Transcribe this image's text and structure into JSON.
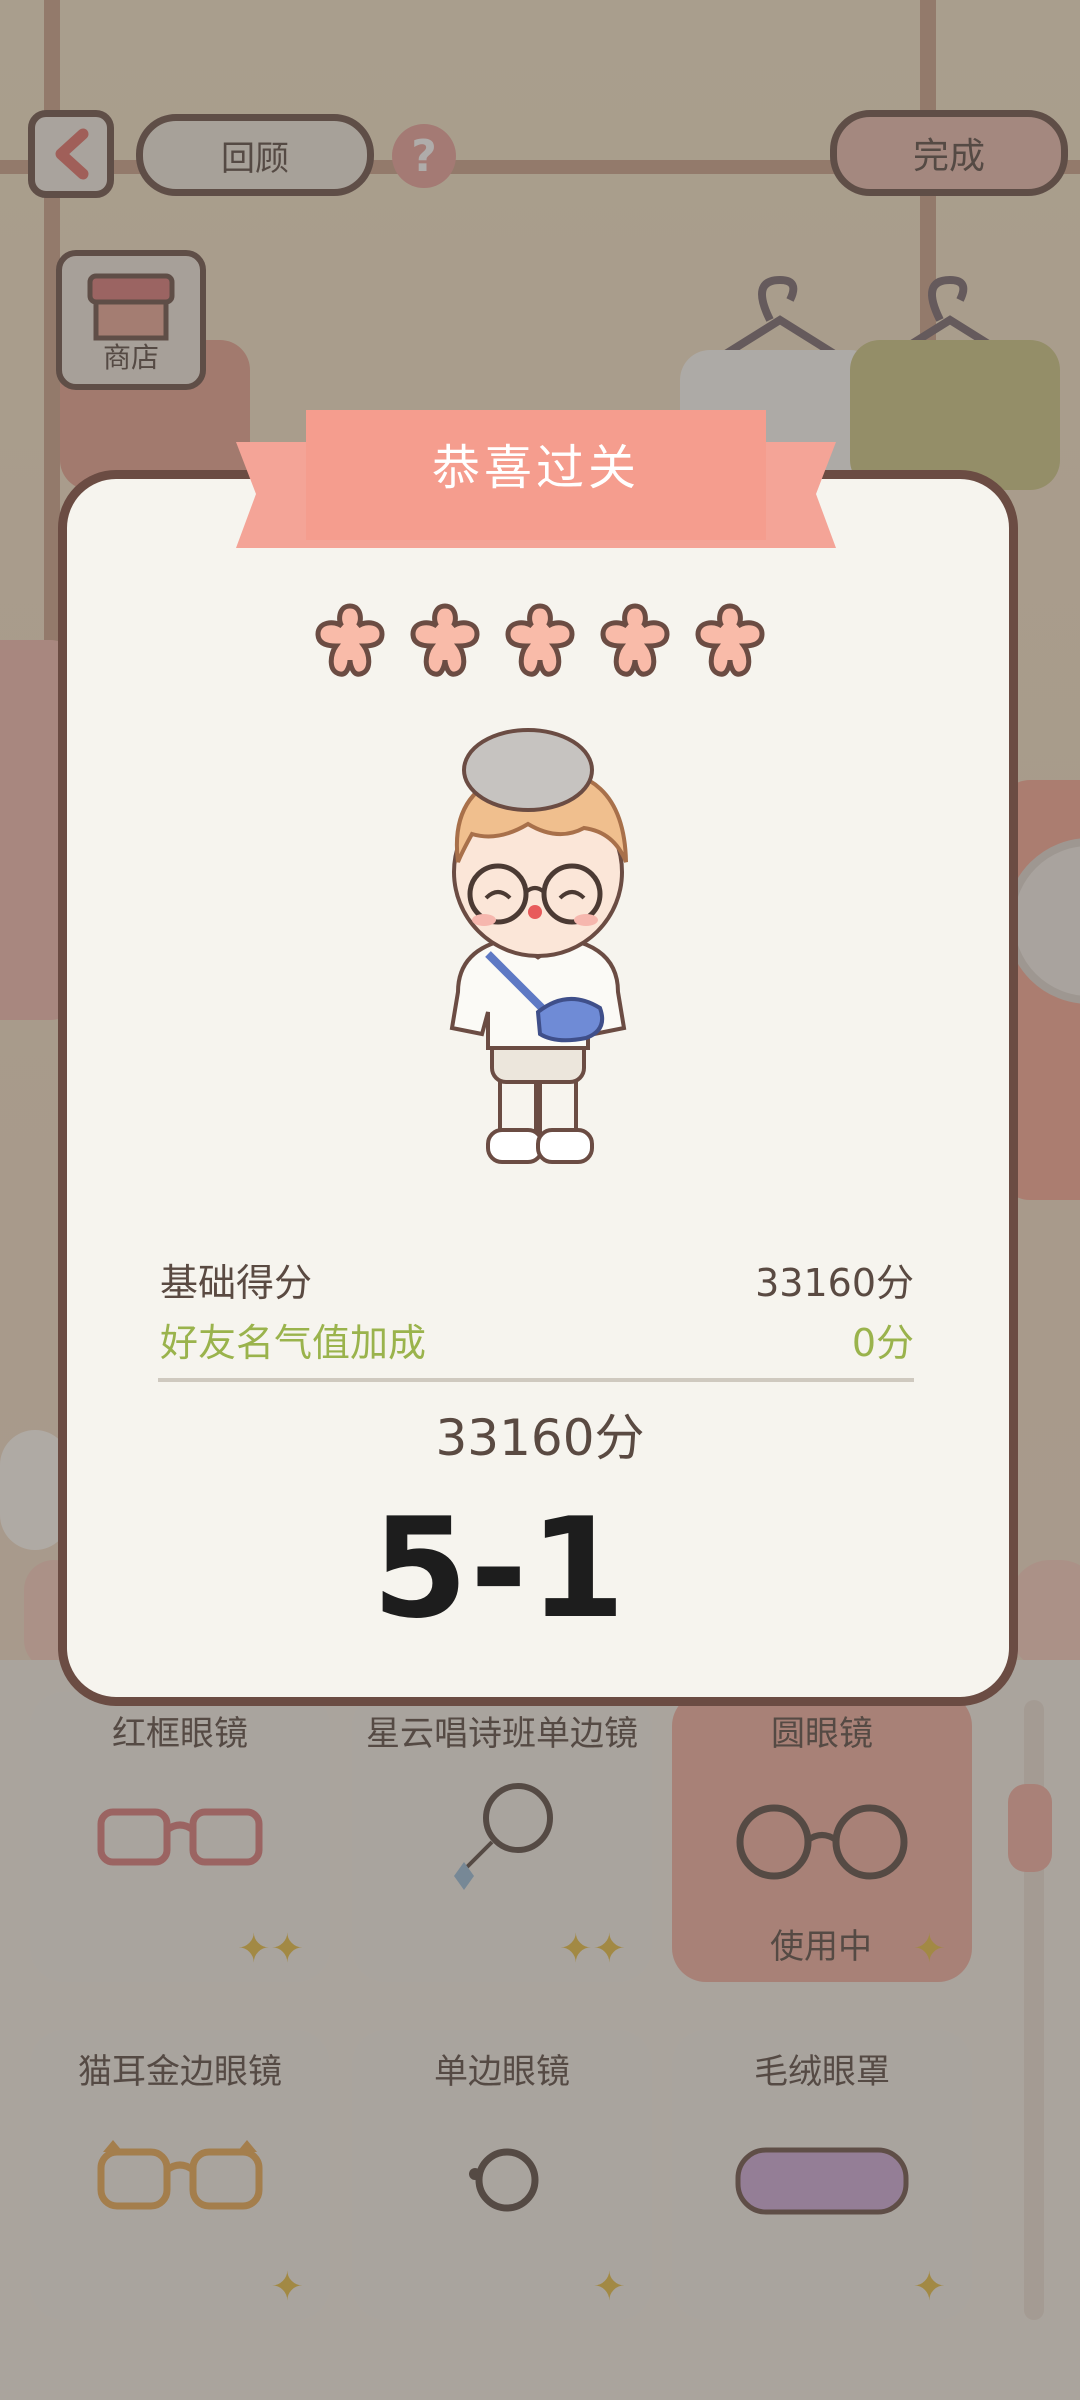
{
  "topbar": {
    "review_label": "回顾",
    "help_symbol": "?",
    "done_label": "完成",
    "shop_label": "商店"
  },
  "modal": {
    "title": "恭喜过关",
    "stars_earned": 5,
    "stars_total": 5,
    "base_score_label": "基础得分",
    "base_score_value": "33160分",
    "bonus_label": "好友名气值加成",
    "bonus_value": "0分",
    "total_score": "33160分",
    "level": "5-1"
  },
  "items": [
    {
      "label": "红框眼镜",
      "icon": "red-frame-glasses-icon",
      "badge": "sparkle-double-icon",
      "active": false,
      "status": ""
    },
    {
      "label": "星云唱诗班单边镜",
      "icon": "monocle-chain-icon",
      "badge": "sparkle-double-icon",
      "active": false,
      "status": ""
    },
    {
      "label": "圆眼镜",
      "icon": "round-glasses-icon",
      "badge": "sparkle-icon",
      "active": true,
      "status": "使用中"
    },
    {
      "label": "猫耳金边眼镜",
      "icon": "cat-ear-glasses-icon",
      "badge": "sparkle-icon",
      "active": false,
      "status": ""
    },
    {
      "label": "单边眼镜",
      "icon": "monocle-icon",
      "badge": "sparkle-icon",
      "active": false,
      "status": ""
    },
    {
      "label": "毛绒眼罩",
      "icon": "plush-eye-mask-icon",
      "badge": "sparkle-icon",
      "active": false,
      "status": ""
    }
  ],
  "colors": {
    "accent": "#f0a999",
    "border": "#6b4c43",
    "bonus_text": "#9ab34c",
    "badge": "#e4b832"
  }
}
